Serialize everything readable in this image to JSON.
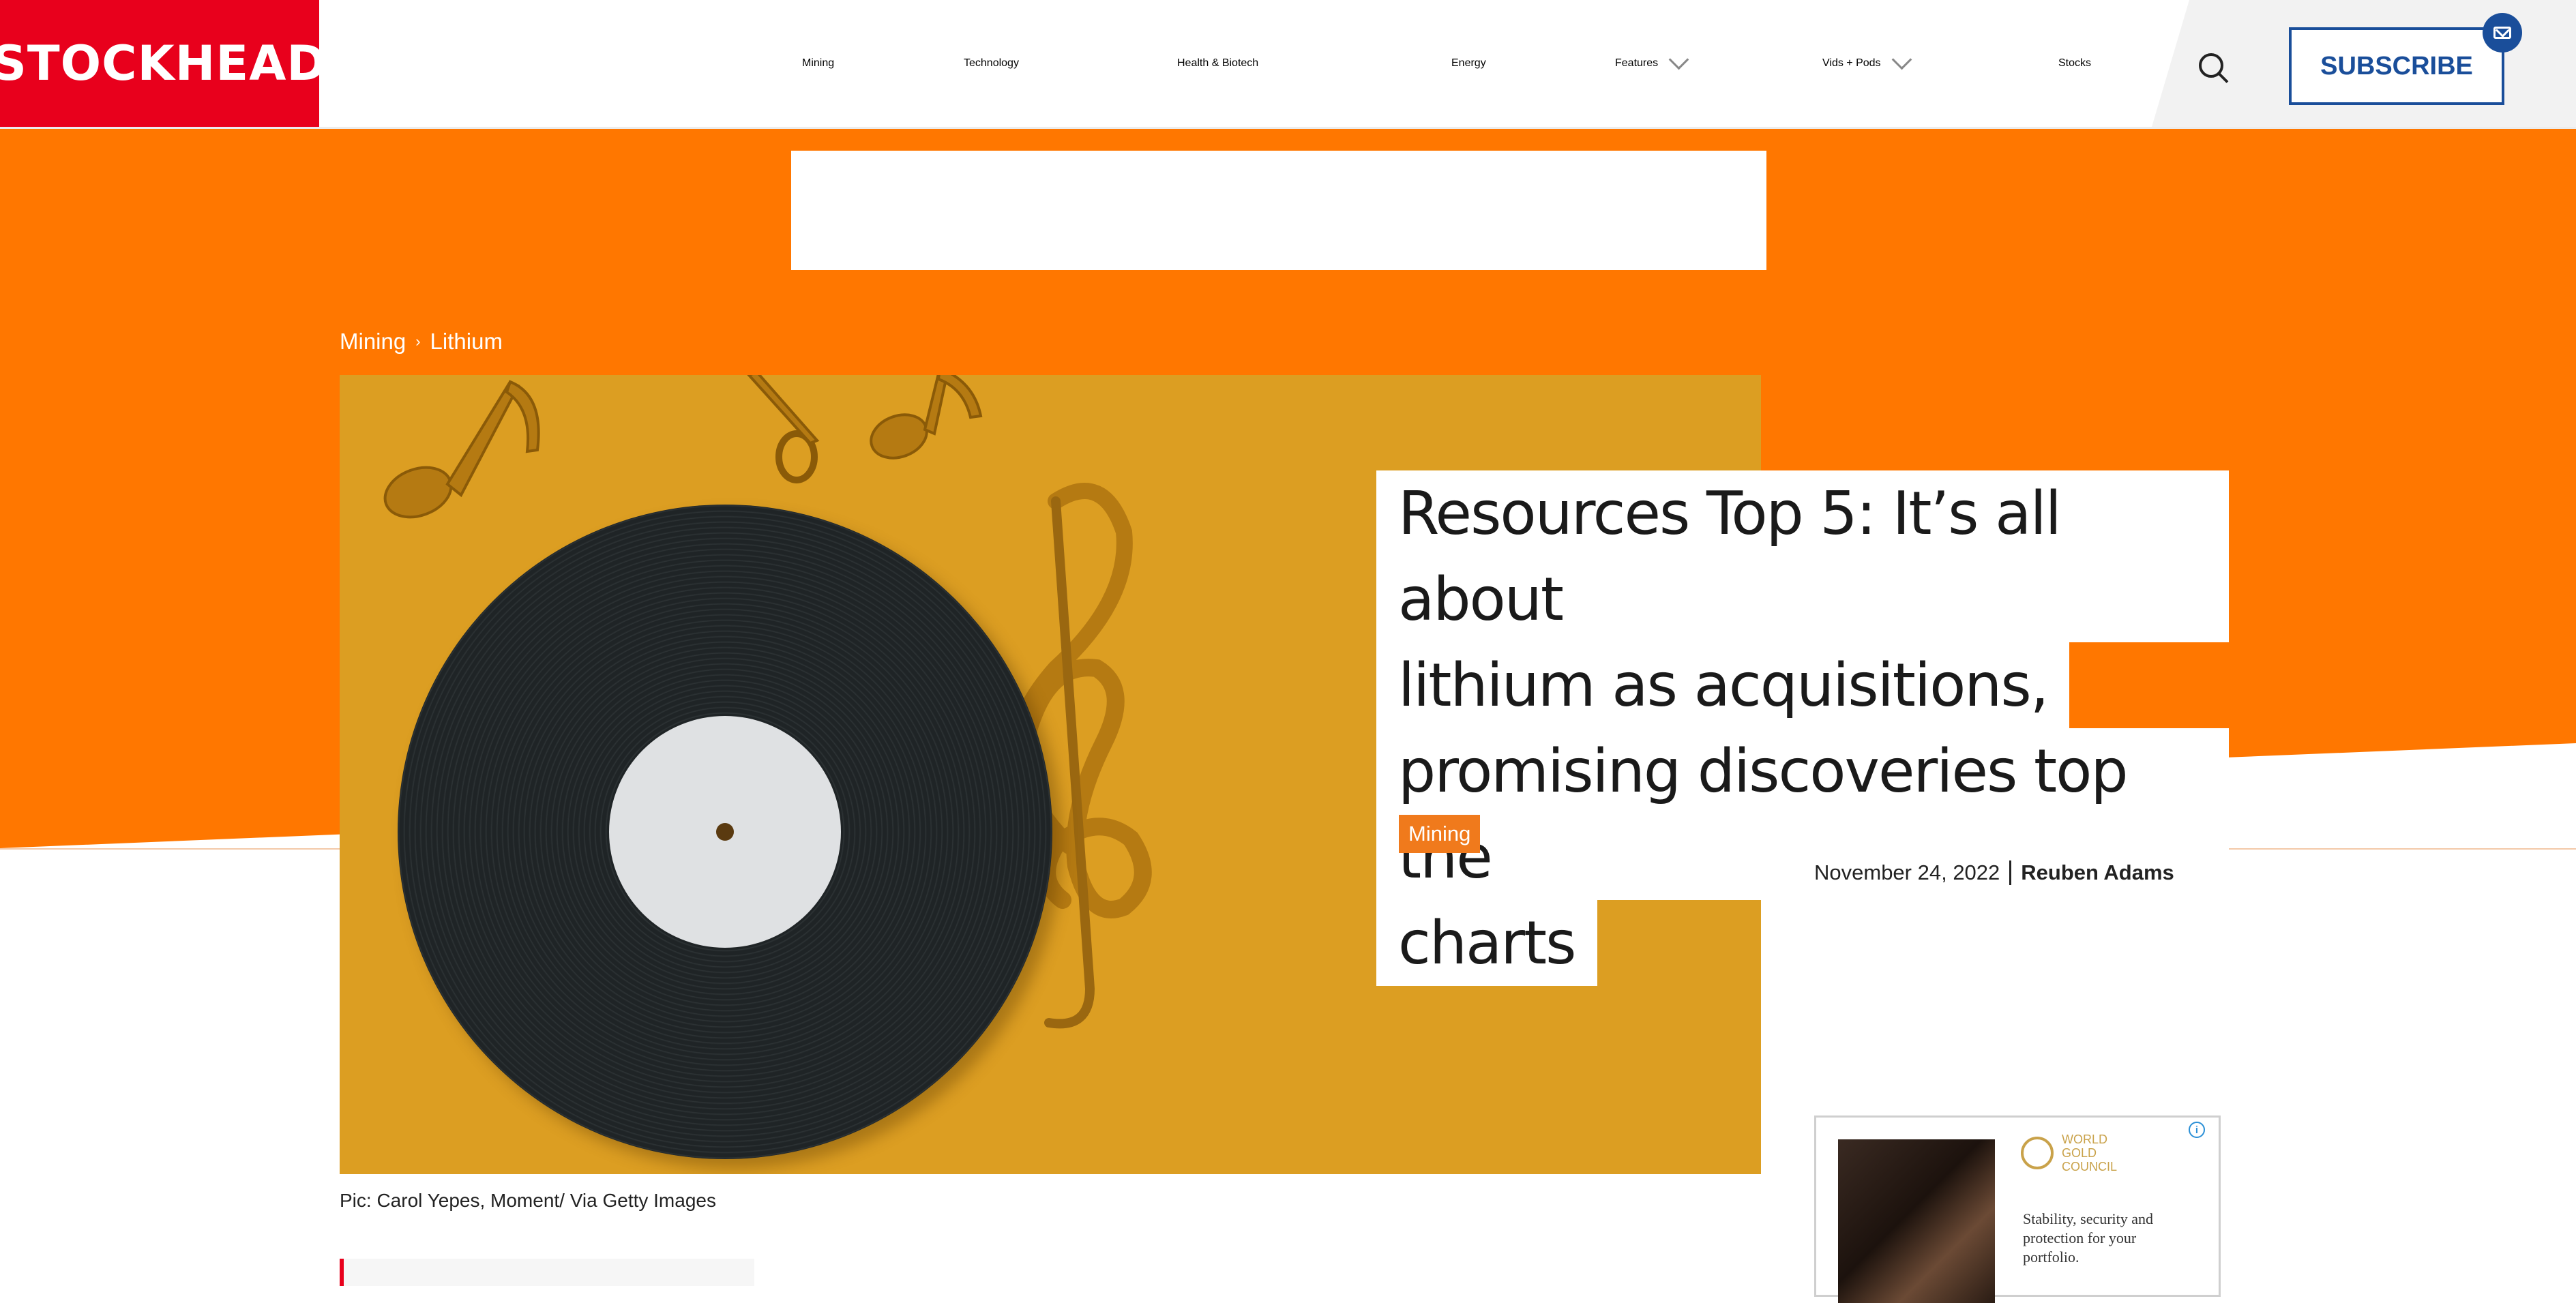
{
  "brand": {
    "name": "STOCKHEAD",
    "color": "#e8001c"
  },
  "nav": {
    "items": [
      {
        "label": "Mining"
      },
      {
        "label": "Technology"
      },
      {
        "label": "Health & Biotech"
      },
      {
        "label": "Energy"
      },
      {
        "label": "Features",
        "has_dropdown": true
      },
      {
        "label": "Vids + Pods",
        "has_dropdown": true
      },
      {
        "label": "Stocks"
      }
    ],
    "subscribe_label": "SUBSCRIBE",
    "accent_color": "#1a4e9a"
  },
  "breadcrumb": {
    "items": [
      "Mining",
      "Lithium"
    ]
  },
  "article": {
    "title_lines": [
      "Resources Top 5: It’s all about",
      "lithium as acquisitions,",
      "promising discoveries top the",
      "charts"
    ],
    "category_tag": "Mining",
    "date": "November 24, 2022",
    "author": "Reuben Adams",
    "image_caption": "Pic: Carol Yepes, Moment/ Via Getty Images"
  },
  "ad": {
    "brand_lines": [
      "WORLD",
      "GOLD",
      "COUNCIL"
    ],
    "text": "Stability, security and protection for your portfolio."
  },
  "colors": {
    "hero_orange": "#ff7700",
    "image_background": "#dc9e22",
    "tag_orange": "#f07a1c"
  }
}
